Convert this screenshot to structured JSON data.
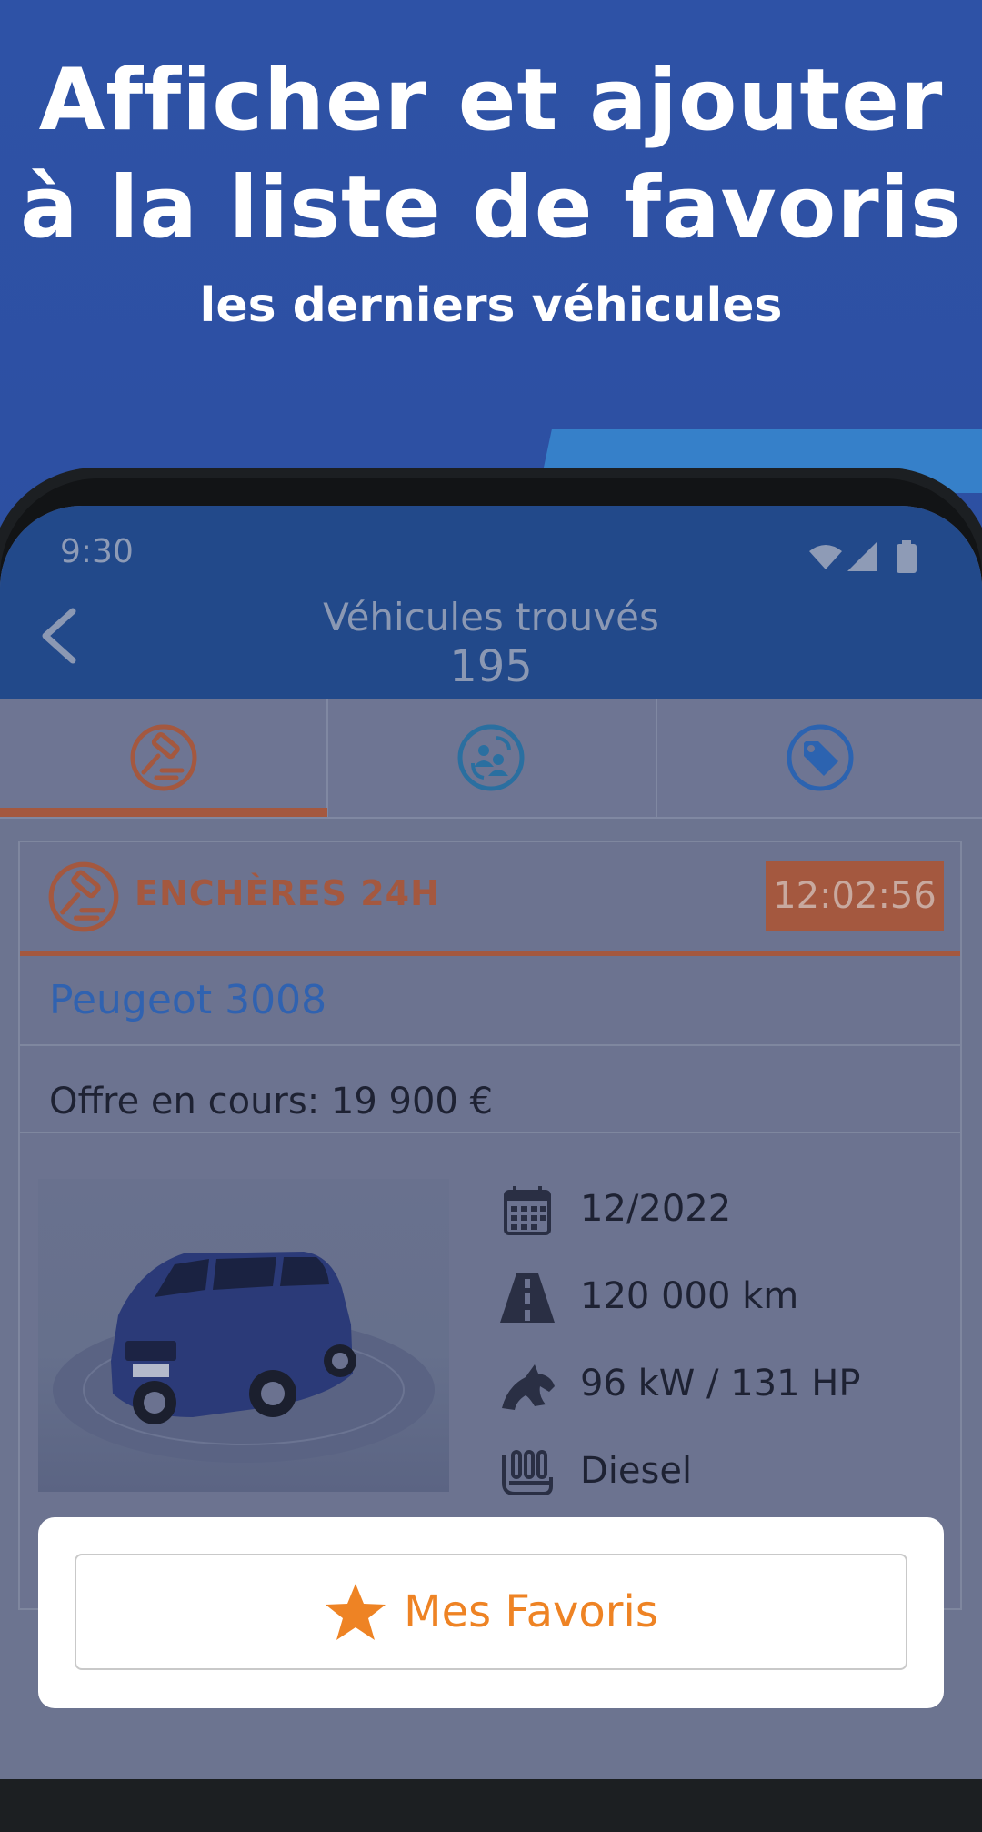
{
  "promo": {
    "headline_line1": "Afficher et ajouter",
    "headline_line2": "à la liste de favoris",
    "subheadline": "les derniers véhicules"
  },
  "status_bar": {
    "time": "9:30",
    "icons": [
      "wifi-icon",
      "signal-icon",
      "battery-icon"
    ]
  },
  "app_bar": {
    "title": "Véhicules trouvés",
    "count": "195",
    "back_icon": "chevron-left-icon"
  },
  "tabs": [
    {
      "icon": "gavel-icon",
      "active": true
    },
    {
      "icon": "people-exchange-icon",
      "active": false
    },
    {
      "icon": "price-tag-icon",
      "active": false
    }
  ],
  "listing": {
    "sale_type": "ENCHÈRES 24H",
    "timer": "12:02:56",
    "model": "Peugeot 3008",
    "offer": "Offre en cours: 19 900 €",
    "photo": "car-photo",
    "specs": [
      {
        "icon": "calendar-icon",
        "value": "12/2022"
      },
      {
        "icon": "road-icon",
        "value": "120 000 km"
      },
      {
        "icon": "horse-icon",
        "value": "96 kW / 131 HP"
      },
      {
        "icon": "engine-icon",
        "value": "Diesel"
      }
    ]
  },
  "favorites": {
    "label": "Mes Favoris",
    "icon": "star-icon"
  },
  "colors": {
    "brand_blue": "#2e52a6",
    "auction_orange": "#a4583f",
    "favorite_orange": "#ee8324",
    "link_blue": "#3062b0"
  }
}
